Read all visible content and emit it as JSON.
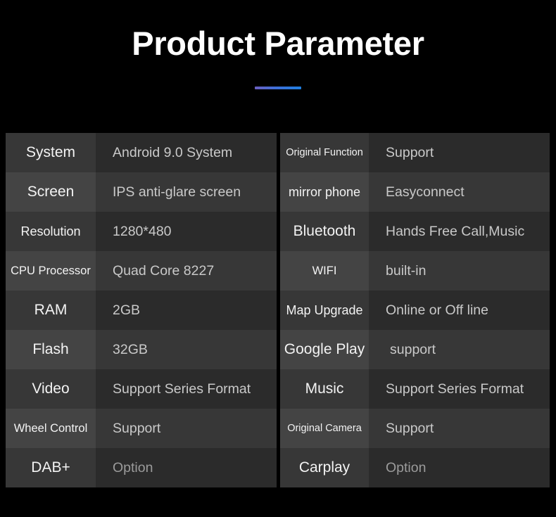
{
  "header": {
    "title": "Product Parameter",
    "accent_color": "#3f6fd8",
    "accent_gradient_from": "#6b5fc0",
    "accent_gradient_to": "#1f7fe0"
  },
  "theme": {
    "background": "#000000",
    "label_row_dark": "#373737",
    "label_row_light": "#444444",
    "value_row_dark": "#2b2b2b",
    "value_row_light": "#373737",
    "label_text": "#f3f3f3",
    "value_text": "#c9c9c9",
    "value_text_dim": "#9b9b9b"
  },
  "spec_table_left": [
    {
      "label": "System",
      "value": "Android 9.0 System"
    },
    {
      "label": "Screen",
      "value": "IPS anti-glare screen"
    },
    {
      "label": "Resolution",
      "value": "1280*480"
    },
    {
      "label": "CPU Processor",
      "value": "Quad Core 8227"
    },
    {
      "label": "RAM",
      "value": "2GB"
    },
    {
      "label": "Flash",
      "value": "32GB"
    },
    {
      "label": "Video",
      "value": "Support Series Format"
    },
    {
      "label": "Wheel Control",
      "value": "Support"
    },
    {
      "label": "DAB+",
      "value": "Option"
    }
  ],
  "spec_table_right": [
    {
      "label": "Original Function",
      "value": "Support"
    },
    {
      "label": "mirror phone",
      "value": "Easyconnect"
    },
    {
      "label": "Bluetooth",
      "value": "Hands Free Call,Music"
    },
    {
      "label": "WIFI",
      "value": "built-in"
    },
    {
      "label": "Map Upgrade",
      "value": "Online or Off line"
    },
    {
      "label": "Google Play",
      "value": "support"
    },
    {
      "label": "Music",
      "value": "Support Series Format"
    },
    {
      "label": "Original Camera",
      "value": "Support"
    },
    {
      "label": "Carplay",
      "value": "Option"
    }
  ]
}
